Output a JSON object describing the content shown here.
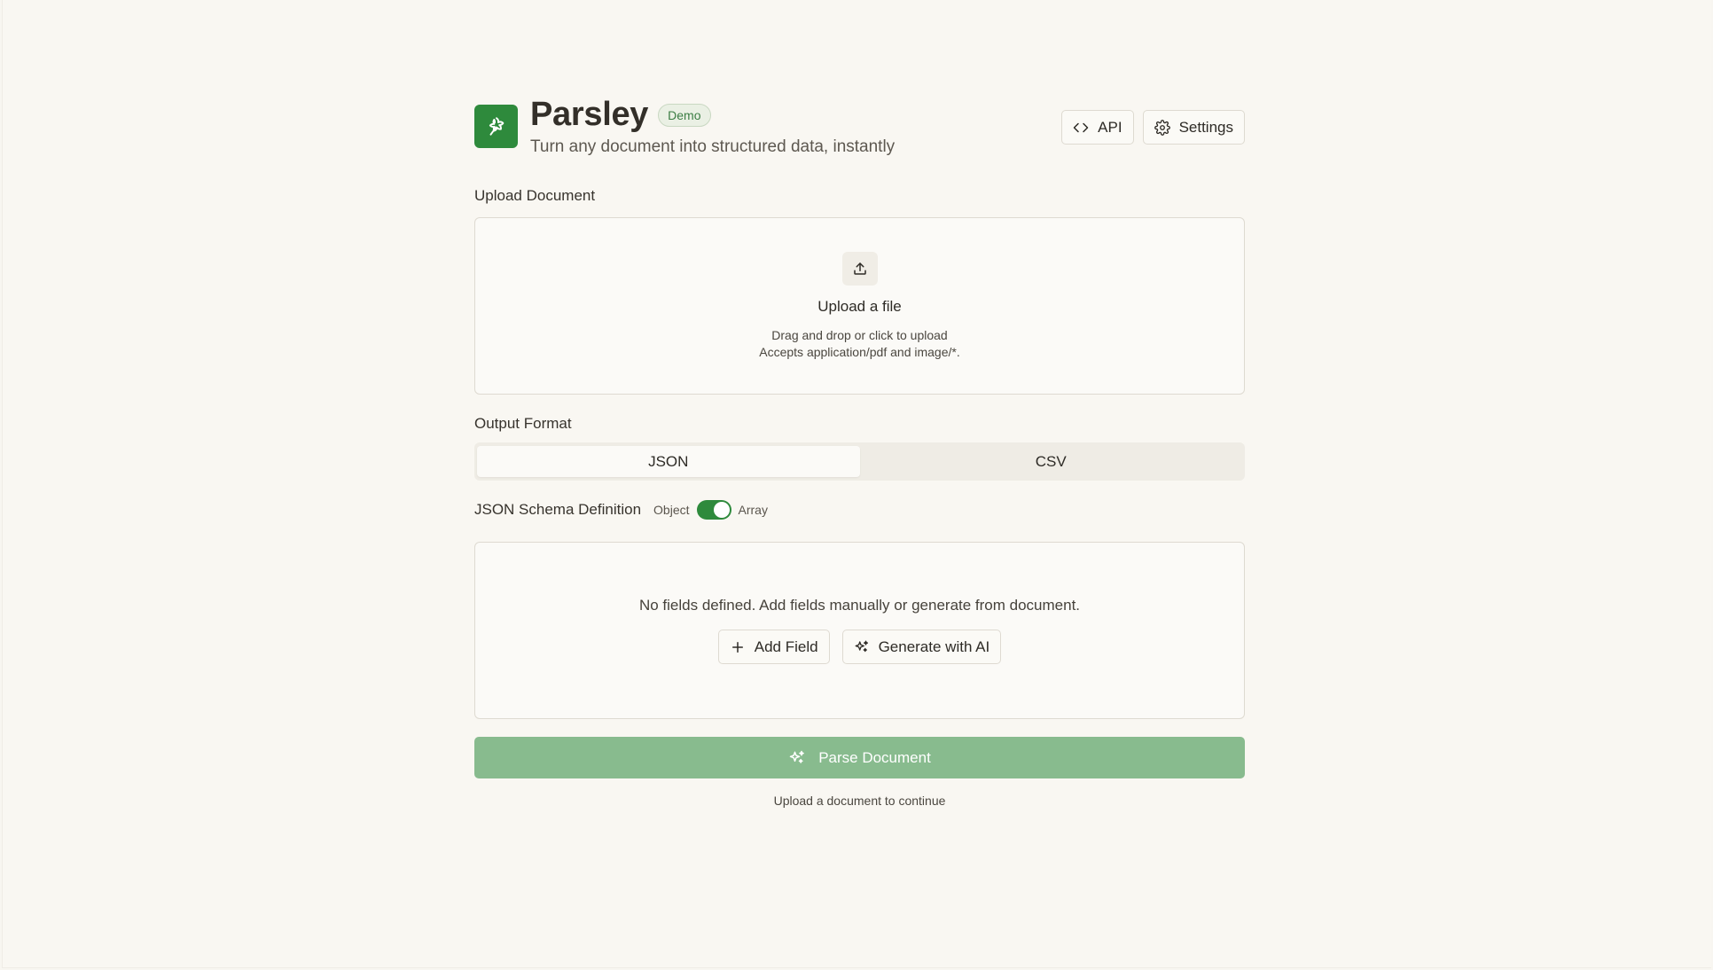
{
  "app": {
    "title": "Parsley",
    "badge": "Demo",
    "subtitle": "Turn any document into structured data, instantly",
    "logo_icon": "parsley-leaf-icon",
    "brand_color": "#2e8a3c"
  },
  "header": {
    "api_label": "API",
    "settings_label": "Settings"
  },
  "upload": {
    "section_label": "Upload Document",
    "title": "Upload a file",
    "line1": "Drag and drop or click to upload",
    "line2": "Accepts application/pdf and image/*.",
    "icon": "upload-icon"
  },
  "output": {
    "section_label": "Output Format",
    "options": [
      "JSON",
      "CSV"
    ],
    "selected": "JSON"
  },
  "schema": {
    "label": "JSON Schema Definition",
    "toggle_left": "Object",
    "toggle_right": "Array",
    "toggle_on": true,
    "empty_message": "No fields defined. Add fields manually or generate from document.",
    "add_field_label": "Add Field",
    "generate_label": "Generate with AI"
  },
  "parse": {
    "button_label": "Parse Document",
    "hint": "Upload a document to continue",
    "button_color": "#88bb8e"
  }
}
